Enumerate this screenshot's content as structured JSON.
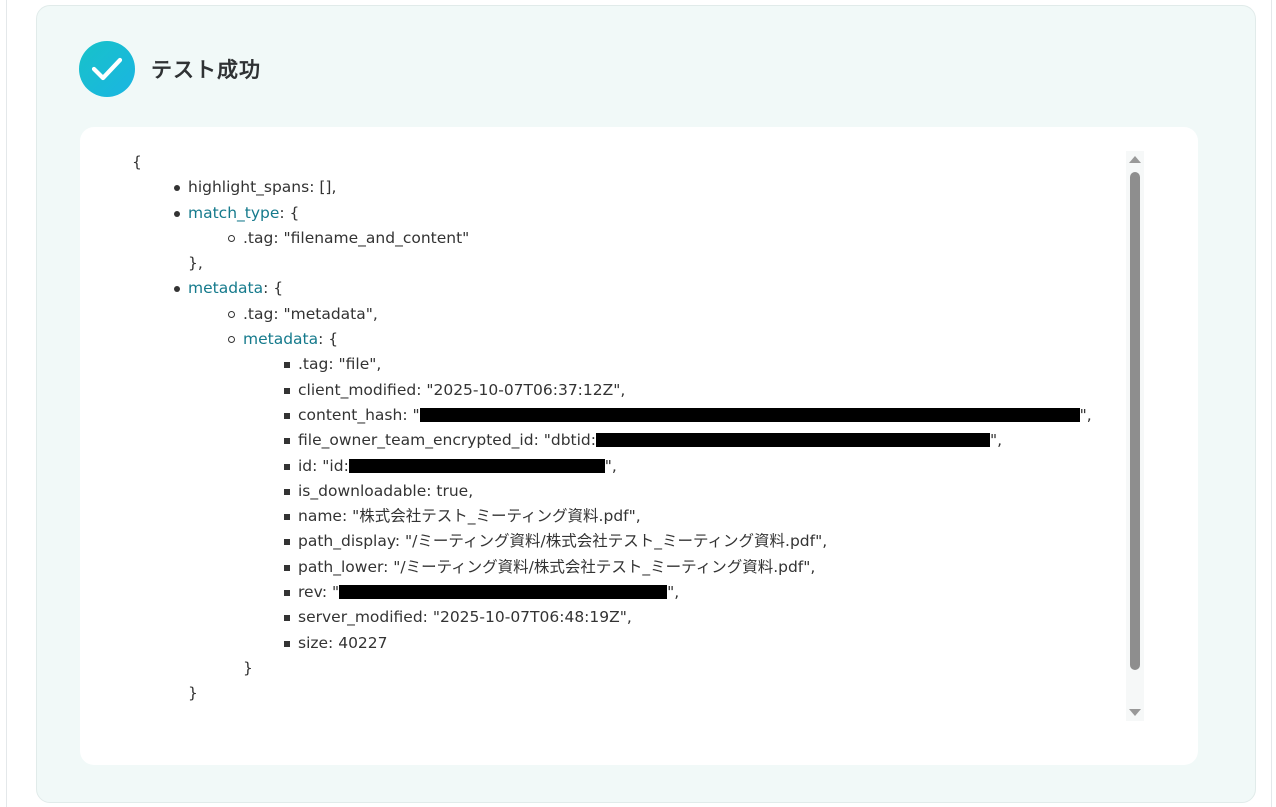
{
  "header": {
    "title": "テスト成功",
    "icon": "check-icon",
    "accent_color": "#1abdd6"
  },
  "json_view": {
    "open_brace": "{",
    "highlight_spans": {
      "key": "highlight_spans",
      "value": ": [],"
    },
    "match_type": {
      "key": "match_type",
      "open": ": {",
      "tag": ".tag: \"filename_and_content\"",
      "close": "},"
    },
    "metadata": {
      "key": "metadata",
      "open": ": {",
      "tag": ".tag: \"metadata\",",
      "inner_key": "metadata",
      "inner_open": ": {",
      "fields": {
        "tag": ".tag: \"file\",",
        "client_modified": "client_modified: \"2025-10-07T06:37:12Z\",",
        "content_hash_prefix": "content_hash: \"",
        "content_hash_suffix": "\",",
        "file_owner_prefix": "file_owner_team_encrypted_id: \"dbtid:",
        "file_owner_suffix": "\",",
        "id_prefix": "id: \"id:",
        "id_suffix": "\",",
        "is_downloadable": "is_downloadable: true,",
        "name": "name: \"株式会社テスト_ミーティング資料.pdf\",",
        "path_display": "path_display: \"/ミーティング資料/株式会社テスト_ミーティング資料.pdf\",",
        "path_lower": "path_lower: \"/ミーティング資料/株式会社テスト_ミーティング資料.pdf\",",
        "rev_prefix": "rev: \"",
        "rev_suffix": "\",",
        "server_modified": "server_modified: \"2025-10-07T06:48:19Z\",",
        "size": "size: 40227"
      },
      "inner_close": "}",
      "close": "}"
    }
  }
}
